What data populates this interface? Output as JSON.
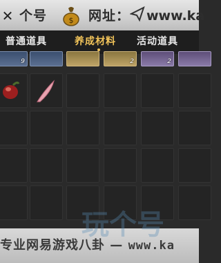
{
  "header": {
    "watermark_part1": "个号",
    "watermark_part2": "网址：",
    "watermark_url": "www.ka"
  },
  "tabs": [
    {
      "label": "普通道具",
      "active": false
    },
    {
      "label": "养成材料",
      "active": true
    },
    {
      "label": "活动道具",
      "active": false
    }
  ],
  "grid": {
    "row1_counts": [
      "9",
      "",
      "",
      "2",
      "2",
      ""
    ]
  },
  "footer": {
    "watermark_cn": "专业网易游戏八卦",
    "watermark_url": "www.ka",
    "logo_text": "玩个号"
  },
  "colors": {
    "active_tab": "#f2c45a",
    "slot_gold": "#bfa467",
    "slot_purple": "#8a7aa8",
    "background": "#2a2a2a"
  }
}
